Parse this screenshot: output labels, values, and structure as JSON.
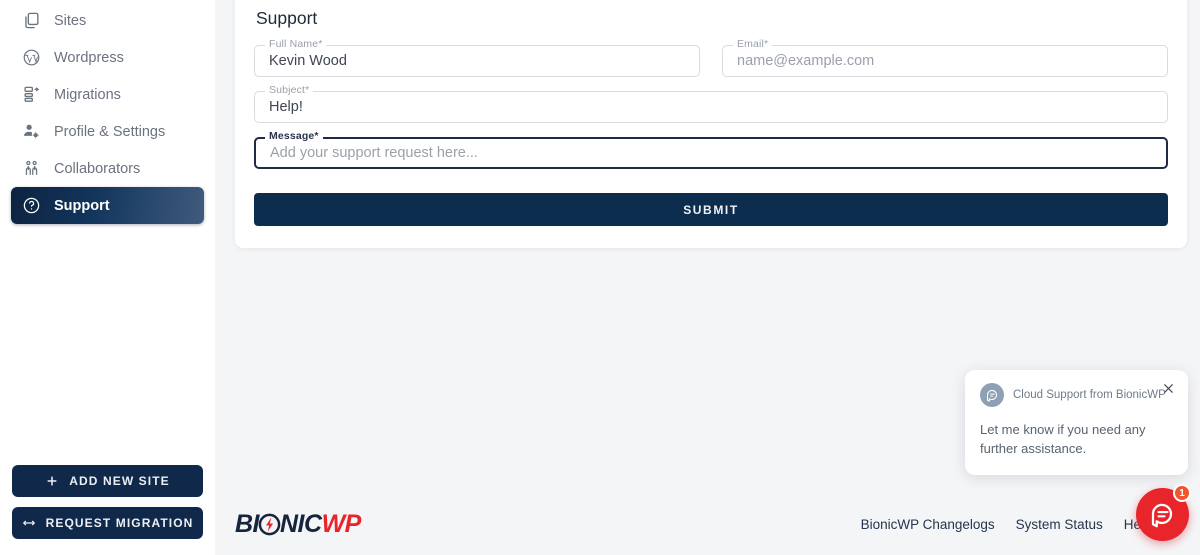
{
  "sidebar": {
    "items": [
      {
        "label": "Sites",
        "icon": "copy-icon",
        "active": false
      },
      {
        "label": "Wordpress",
        "icon": "wordpress-icon",
        "active": false
      },
      {
        "label": "Migrations",
        "icon": "migration-icon",
        "active": false
      },
      {
        "label": "Profile & Settings",
        "icon": "person-gear-icon",
        "active": false
      },
      {
        "label": "Collaborators",
        "icon": "people-icon",
        "active": false
      },
      {
        "label": "Support",
        "icon": "question-circle-icon",
        "active": true
      }
    ],
    "add_site_label": "ADD NEW SITE",
    "request_migration_label": "REQUEST MIGRATION"
  },
  "main": {
    "page_title": "Support",
    "fields": {
      "full_name": {
        "label": "Full Name*",
        "value": "Kevin Wood",
        "is_placeholder": false
      },
      "email": {
        "label": "Email*",
        "value": "name@example.com",
        "is_placeholder": true
      },
      "subject": {
        "label": "Subject*",
        "value": "Help!",
        "is_placeholder": false
      },
      "message": {
        "label": "Message*",
        "value": "Add your support request here...",
        "is_placeholder": true
      }
    },
    "submit_label": "SUBMIT"
  },
  "footer": {
    "logo_primary": "BI",
    "logo_mid": "NIC",
    "logo_accent": "WP",
    "links": [
      {
        "label": "BionicWP Changelogs"
      },
      {
        "label": "System Status"
      },
      {
        "label": "Help Docs"
      }
    ]
  },
  "chat": {
    "sender": "Cloud Support from BionicWP",
    "message": "Let me know if you need any further assistance.",
    "badge_count": "1",
    "close_icon": "close-icon",
    "launcher_icon": "chat-bubble-icon"
  },
  "colors": {
    "navy": "#0d2d4e",
    "sidebar_active_start": "#0d2340",
    "sidebar_active_end": "#3f5b7d",
    "accent_red": "#e8252a",
    "page_bg": "#f4f5f7",
    "card_bg": "#ffffff"
  }
}
